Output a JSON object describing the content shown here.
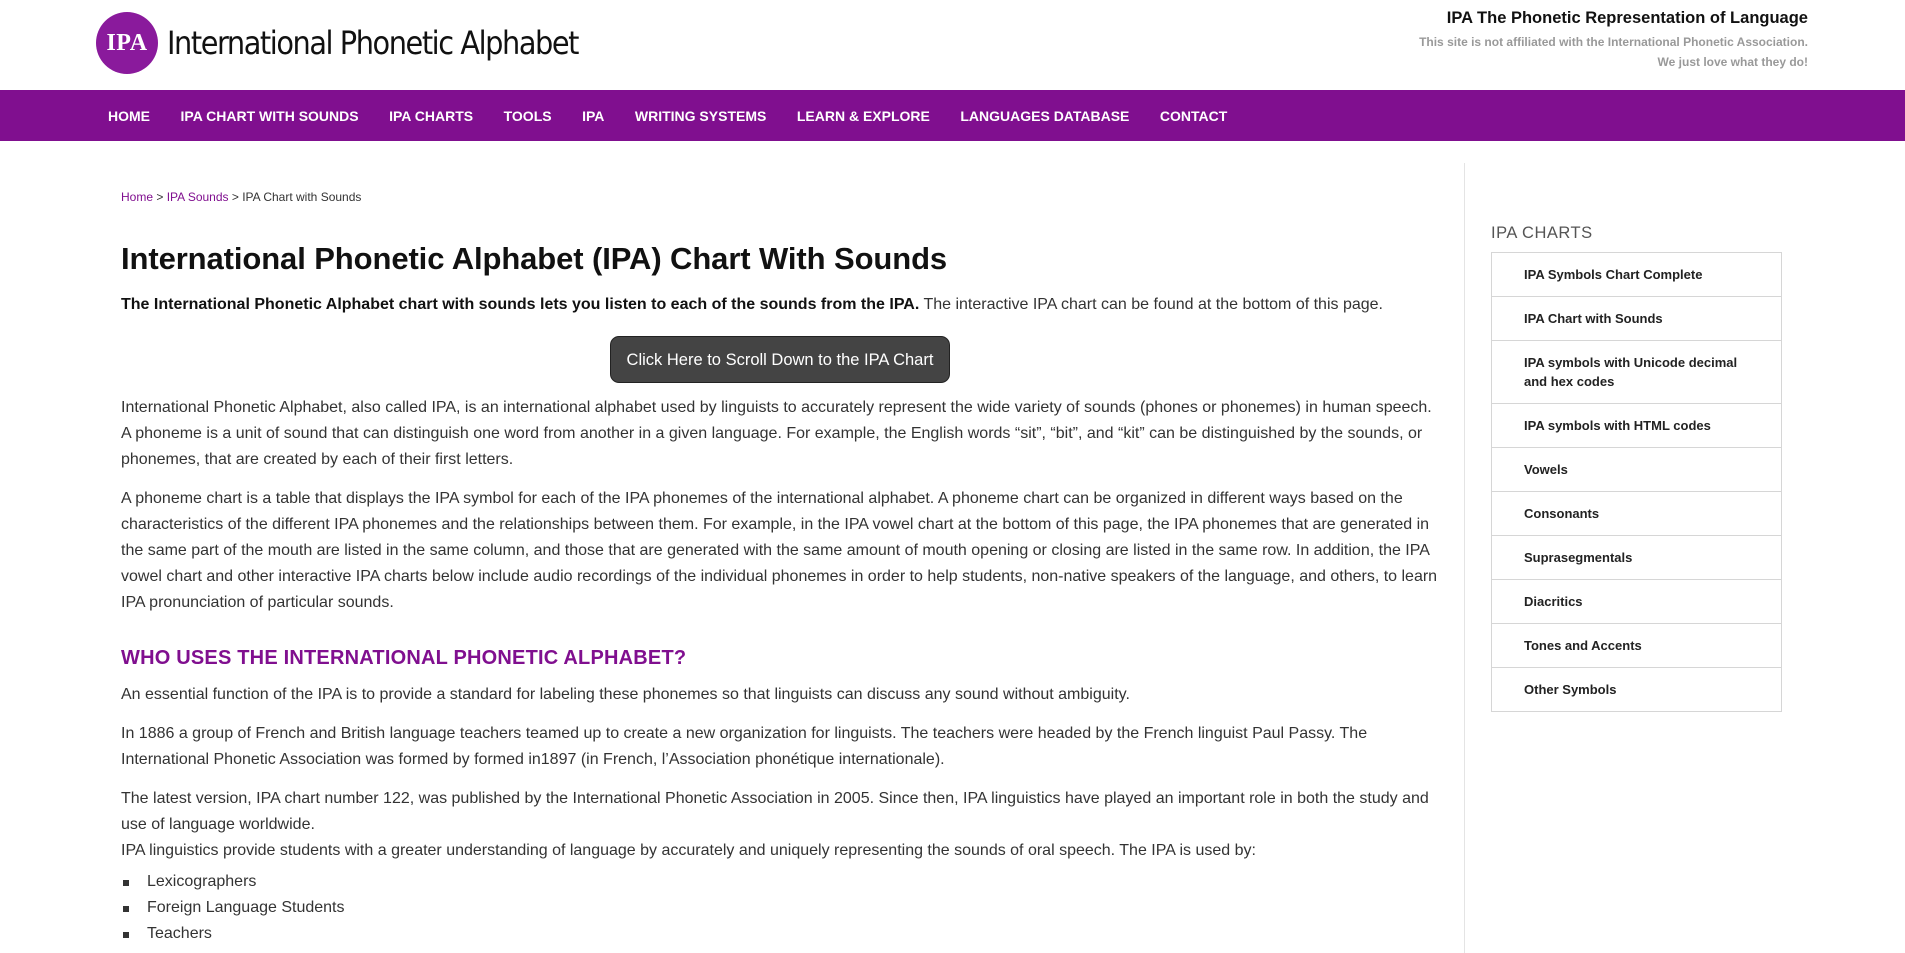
{
  "header": {
    "logo_badge": "IPA",
    "logo_text": "International Phonetic Alphabet",
    "tagline_title": "IPA The Phonetic Representation of Language",
    "tagline_line1": "This site is not affiliated with the International Phonetic Association.",
    "tagline_line2": "We just love what they do!"
  },
  "nav": {
    "items": [
      "HOME",
      "IPA CHART WITH SOUNDS",
      "IPA CHARTS",
      "TOOLS",
      "IPA",
      "WRITING SYSTEMS",
      "LEARN & EXPLORE",
      "LANGUAGES DATABASE",
      "CONTACT"
    ]
  },
  "breadcrumb": {
    "home": "Home",
    "sep1": " > ",
    "sounds": "IPA Sounds",
    "sep2": " > ",
    "current": "IPA Chart with Sounds"
  },
  "main": {
    "title": "International Phonetic Alphabet (IPA) Chart With Sounds",
    "intro_bold": "The International Phonetic Alphabet chart with sounds lets you listen to each of the sounds from the IPA.",
    "intro_rest": " The interactive IPA chart can be found at the bottom of this page.",
    "scroll_button": "Click Here to Scroll Down to the IPA Chart",
    "para1": "International Phonetic Alphabet, also called IPA, is an international alphabet used by linguists to accurately represent the wide variety of sounds (phones or phonemes) in human speech. A phoneme is a unit of sound that can distinguish one word from another in a given language. For example, the English words “sit”, “bit”, and “kit” can be distinguished by the sounds, or phonemes, that are created by each of their first letters.",
    "para2": "A phoneme chart is a table that displays the IPA symbol for each of the IPA phonemes of the international alphabet. A phoneme chart can be organized in different ways based on the characteristics of the different IPA phonemes and the relationships between them. For example, in the IPA vowel chart at the bottom of this page, the IPA phonemes that are generated in the same part of the mouth are listed in the same column, and those that are generated with the same amount of mouth opening or closing are listed in the same row. In addition, the IPA vowel chart and other interactive IPA charts below include audio recordings of the individual phonemes in order to help students, non-native speakers of the language, and others, to learn IPA pronunciation of particular sounds.",
    "section_heading": "WHO USES THE INTERNATIONAL PHONETIC ALPHABET?",
    "para3": "An essential function of the IPA is to provide a standard for labeling these phonemes so that linguists can discuss any sound without ambiguity.",
    "para4": "In 1886 a group of French and British language teachers teamed up to create a new organization for linguists. The teachers were headed by the French linguist Paul Passy. The International Phonetic Association was formed by formed in1897 (in French, l’Association phonétique internationale).",
    "para5": "The latest version, IPA chart number 122, was published by the International Phonetic Association in 2005. Since then, IPA linguistics have played an important role in both the study and use of language worldwide.",
    "para6": "IPA linguistics provide students with a greater understanding of language by accurately and uniquely representing the sounds of oral speech. The IPA is used by:",
    "users": [
      "Lexicographers",
      "Foreign Language Students",
      "Teachers"
    ]
  },
  "sidebar": {
    "title": "IPA CHARTS",
    "items": [
      "IPA Symbols Chart Complete",
      "IPA Chart with Sounds",
      "IPA symbols with Unicode decimal and hex codes",
      "IPA symbols with HTML codes",
      "Vowels",
      "Consonants",
      "Suprasegmentals",
      "Diacritics",
      "Tones and Accents",
      "Other Symbols"
    ]
  },
  "colors": {
    "brand_purple": "#800f8f",
    "button_dark": "#444444"
  }
}
